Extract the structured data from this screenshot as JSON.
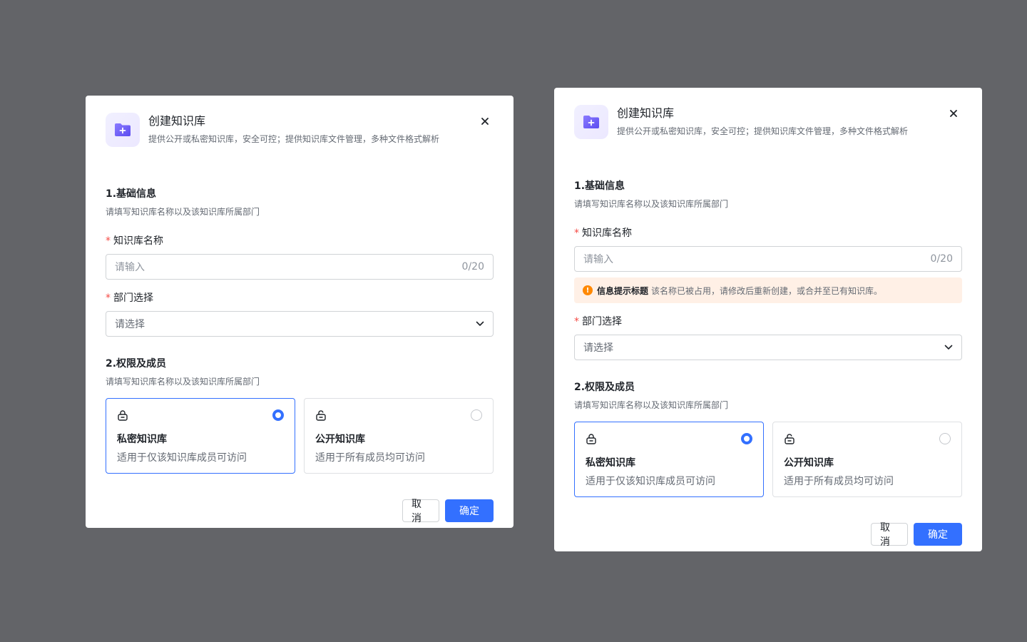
{
  "colors": {
    "backdrop": "#636468",
    "primary": "#3370ff",
    "warning": "#ff8800",
    "required": "#f54a45"
  },
  "dialog": {
    "icon": "folder-plus-icon",
    "title": "创建知识库",
    "subtitle": "提供公开或私密知识库，安全可控；提供知识库文件管理，多种文件格式解析",
    "close_icon": "close-icon",
    "section1_title": "1.基础信息",
    "section1_desc": "请填写知识库名称以及该知识库所属部门",
    "required_mark": "*",
    "name_label": "知识库名称",
    "name_placeholder": "请输入",
    "name_counter": "0/20",
    "dept_label": "部门选择",
    "dept_placeholder": "请选择",
    "section2_title": "2.权限及成员",
    "section2_desc": "请填写知识库名称以及该知识库所属部门",
    "private_title": "私密知识库",
    "private_desc": "适用于仅该知识库成员可访问",
    "private_icon": "lock-icon",
    "private_selected": true,
    "public_title": "公开知识库",
    "public_desc": "适用于所有成员均可访问",
    "public_icon": "unlock-icon",
    "public_selected": false,
    "cancel_label": "取消",
    "ok_label": "确定",
    "alert_icon": "warning-icon",
    "alert_icon_glyph": "!",
    "alert_title": "信息提示标题",
    "alert_text": "该名称已被占用，请修改后重新创建，或合并至已有知识库。"
  }
}
